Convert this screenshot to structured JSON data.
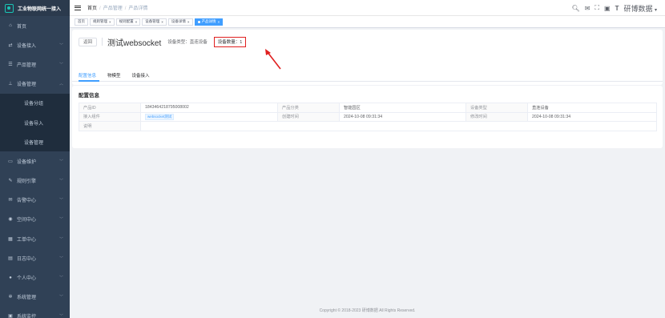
{
  "app": {
    "title": "工业物联网统一接入"
  },
  "sidebar": {
    "items": [
      {
        "label": "首页",
        "icon": "home-icon",
        "glyph": "⌂",
        "chevron": false
      },
      {
        "label": "设备接入",
        "icon": "link-icon",
        "glyph": "⇄",
        "chevron": true
      },
      {
        "label": "产品管理",
        "icon": "list-icon",
        "glyph": "☰",
        "chevron": true
      },
      {
        "label": "设备管理",
        "icon": "tree-icon",
        "glyph": "⊥",
        "chevron": true,
        "expanded": true
      },
      {
        "label": "设备分组",
        "sub": true
      },
      {
        "label": "设备导入",
        "sub": true
      },
      {
        "label": "设备管理",
        "sub": true,
        "active": true
      },
      {
        "label": "设备维护",
        "icon": "monitor-icon",
        "glyph": "▭",
        "chevron": true
      },
      {
        "label": "规则引擎",
        "icon": "edit-icon",
        "glyph": "✎",
        "chevron": true
      },
      {
        "label": "告警中心",
        "icon": "mail-icon",
        "glyph": "✉",
        "chevron": true
      },
      {
        "label": "空间中心",
        "icon": "globe-icon",
        "glyph": "◉",
        "chevron": true
      },
      {
        "label": "工单中心",
        "icon": "grid-icon",
        "glyph": "▦",
        "chevron": true
      },
      {
        "label": "日志中心",
        "icon": "document-icon",
        "glyph": "▤",
        "chevron": true
      },
      {
        "label": "个人中心",
        "icon": "user-icon",
        "glyph": "●",
        "chevron": true
      },
      {
        "label": "系统管理",
        "icon": "gear-icon",
        "glyph": "✲",
        "chevron": true
      },
      {
        "label": "系统监控",
        "icon": "monitor-icon",
        "glyph": "▣",
        "chevron": true
      }
    ]
  },
  "breadcrumb": {
    "home": "首页",
    "level1": "产品管理",
    "level2": "产品详情"
  },
  "topbar": {
    "username": "研博数据",
    "caret": "▾"
  },
  "tags": [
    {
      "label": "首页",
      "closable": false
    },
    {
      "label": "规则管理",
      "closable": true
    },
    {
      "label": "规则配置",
      "closable": true
    },
    {
      "label": "设备管理",
      "closable": true
    },
    {
      "label": "设备详情",
      "closable": true
    },
    {
      "label": "产品详情",
      "closable": true,
      "active": true
    }
  ],
  "detail": {
    "back_label": "返回",
    "product_name": "测试websocket",
    "device_type_text": "设备类型：直连设备",
    "device_count_text": "设备数量：1"
  },
  "tabs": [
    {
      "label": "配置信息",
      "active": true
    },
    {
      "label": "物模型"
    },
    {
      "label": "设备接入"
    }
  ],
  "config": {
    "section_title": "配置信息",
    "rows": [
      [
        {
          "label": "产品ID",
          "value": "1843464218795008002"
        },
        {
          "label": "产品分类",
          "value": "智能园区"
        },
        {
          "label": "设备类型",
          "value": "直连设备"
        }
      ],
      [
        {
          "label": "接入组件",
          "value": "websocket测试",
          "tag": true
        },
        {
          "label": "创建时间",
          "value": "2024-10-08 09:31:34"
        },
        {
          "label": "修改时间",
          "value": "2024-10-08 09:31:34"
        }
      ],
      [
        {
          "label": "说明",
          "value": ""
        }
      ]
    ]
  },
  "footer": {
    "text": "Copyright © 2018-2023 研博数据 All Rights Reserved."
  },
  "colors": {
    "sidebar": "#304156",
    "accent": "#409eff",
    "highlight": "#e02020"
  }
}
